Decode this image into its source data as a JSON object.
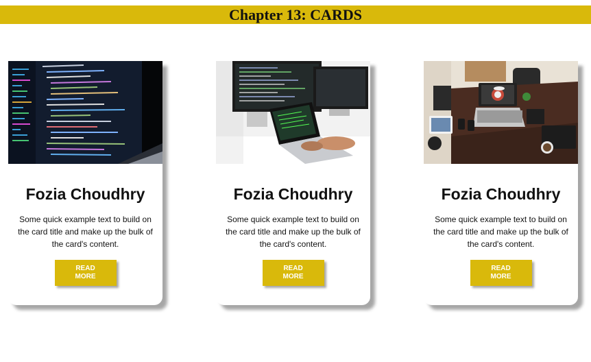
{
  "header": {
    "title": "Chapter 13: CARDS",
    "color": "#d9b90b"
  },
  "cards": [
    {
      "image": "code-editor-laptop-photo",
      "title": "Fozia Choudhry",
      "text": "Some quick example text to build on the card title and make up the bulk of the card's content.",
      "button_label": "READ MORE"
    },
    {
      "image": "developer-desk-monitors-photo",
      "title": "Fozia Choudhry",
      "text": "Some quick example text to build on the card title and make up the bulk of the card's content.",
      "button_label": "READ MORE"
    },
    {
      "image": "workspace-topdown-photo",
      "title": "Fozia Choudhry",
      "text": "Some quick example text to build on the card title and make up the bulk of the card's content.",
      "button_label": "READ MORE"
    }
  ],
  "accent_color": "#d9b90b"
}
